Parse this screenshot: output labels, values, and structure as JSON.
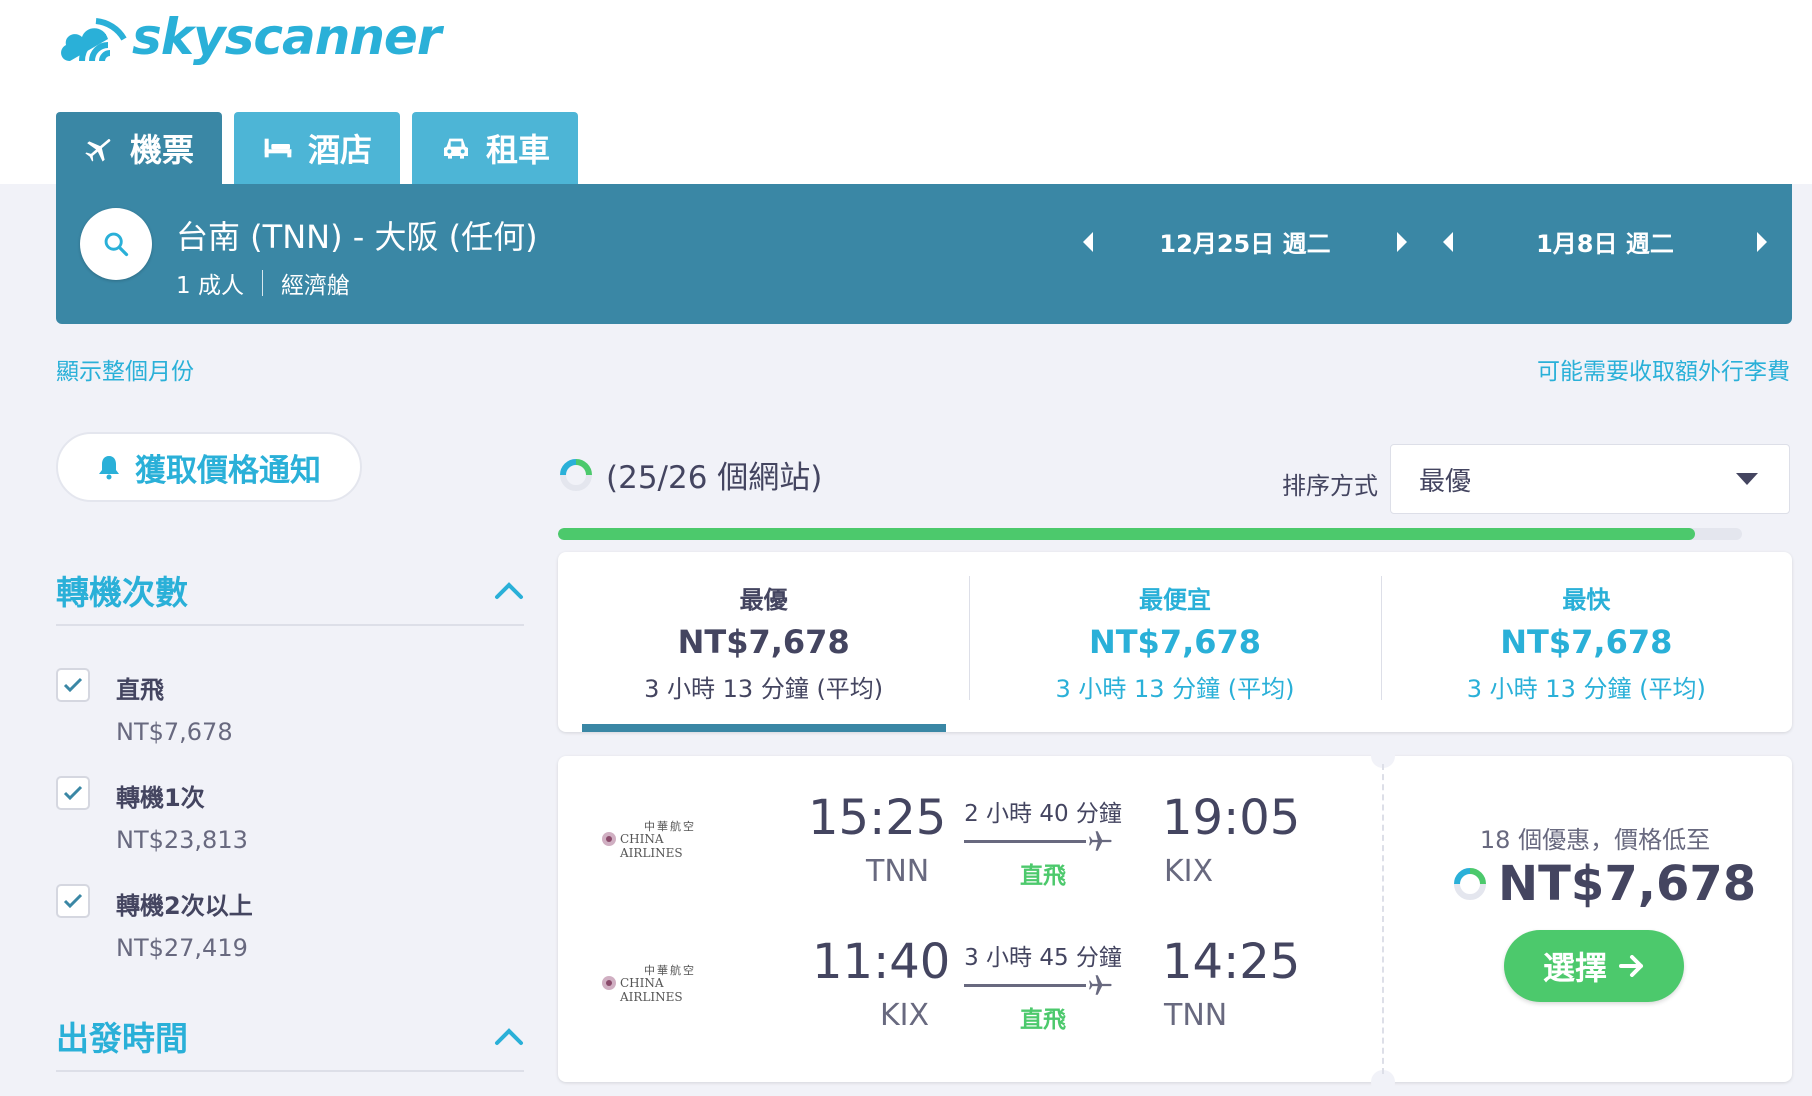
{
  "brand": {
    "name": "skyscanner",
    "color": "#2ab0d8"
  },
  "tabs": [
    {
      "label": "機票",
      "icon": "plane-icon"
    },
    {
      "label": "酒店",
      "icon": "bed-icon"
    },
    {
      "label": "租車",
      "icon": "car-icon"
    }
  ],
  "search": {
    "route": "台南 (TNN) - 大阪 (任何)",
    "passengers": "1 成人",
    "cabin": "經濟艙",
    "depart_date": "12月25日 週二",
    "return_date": "1月8日 週二"
  },
  "links": {
    "show_month": "顯示整個月份",
    "baggage_fee": "可能需要收取額外行李費"
  },
  "price_alert_label": "獲取價格通知",
  "filters": {
    "stops": {
      "title": "轉機次數",
      "items": [
        {
          "label": "直飛",
          "price": "NT$7,678",
          "checked": true
        },
        {
          "label": "轉機1次",
          "price": "NT$23,813",
          "checked": true
        },
        {
          "label": "轉機2次以上",
          "price": "NT$27,419",
          "checked": true
        }
      ]
    },
    "departure_time": {
      "title": "出發時間"
    }
  },
  "progress": {
    "text": "(25/26 個網站)",
    "fraction": 0.96
  },
  "sort": {
    "label": "排序方式",
    "value": "最優"
  },
  "sort_tabs": [
    {
      "title": "最優",
      "price": "NT$7,678",
      "duration": "3 小時 13 分鐘 (平均)",
      "active": true
    },
    {
      "title": "最便宜",
      "price": "NT$7,678",
      "duration": "3 小時 13 分鐘 (平均)",
      "active": false
    },
    {
      "title": "最快",
      "price": "NT$7,678",
      "duration": "3 小時 13 分鐘 (平均)",
      "active": false
    }
  ],
  "result": {
    "legs": [
      {
        "airline_cn": "中華航空",
        "airline_en": "CHINA AIRLINES",
        "depart_time": "15:25",
        "depart_code": "TNN",
        "duration": "2 小時 40 分鐘",
        "stops": "直飛",
        "arrive_time": "19:05",
        "arrive_code": "KIX"
      },
      {
        "airline_cn": "中華航空",
        "airline_en": "CHINA AIRLINES",
        "depart_time": "11:40",
        "depart_code": "KIX",
        "duration": "3 小時 45 分鐘",
        "stops": "直飛",
        "arrive_time": "14:25",
        "arrive_code": "TNN"
      }
    ],
    "deals_text": "18 個優惠，價格低至",
    "price": "NT$7,678",
    "select_label": "選擇"
  },
  "colors": {
    "teal": "#3a87a5",
    "light_blue": "#4db5d6",
    "green": "#4cc96c",
    "text": "#444560"
  }
}
